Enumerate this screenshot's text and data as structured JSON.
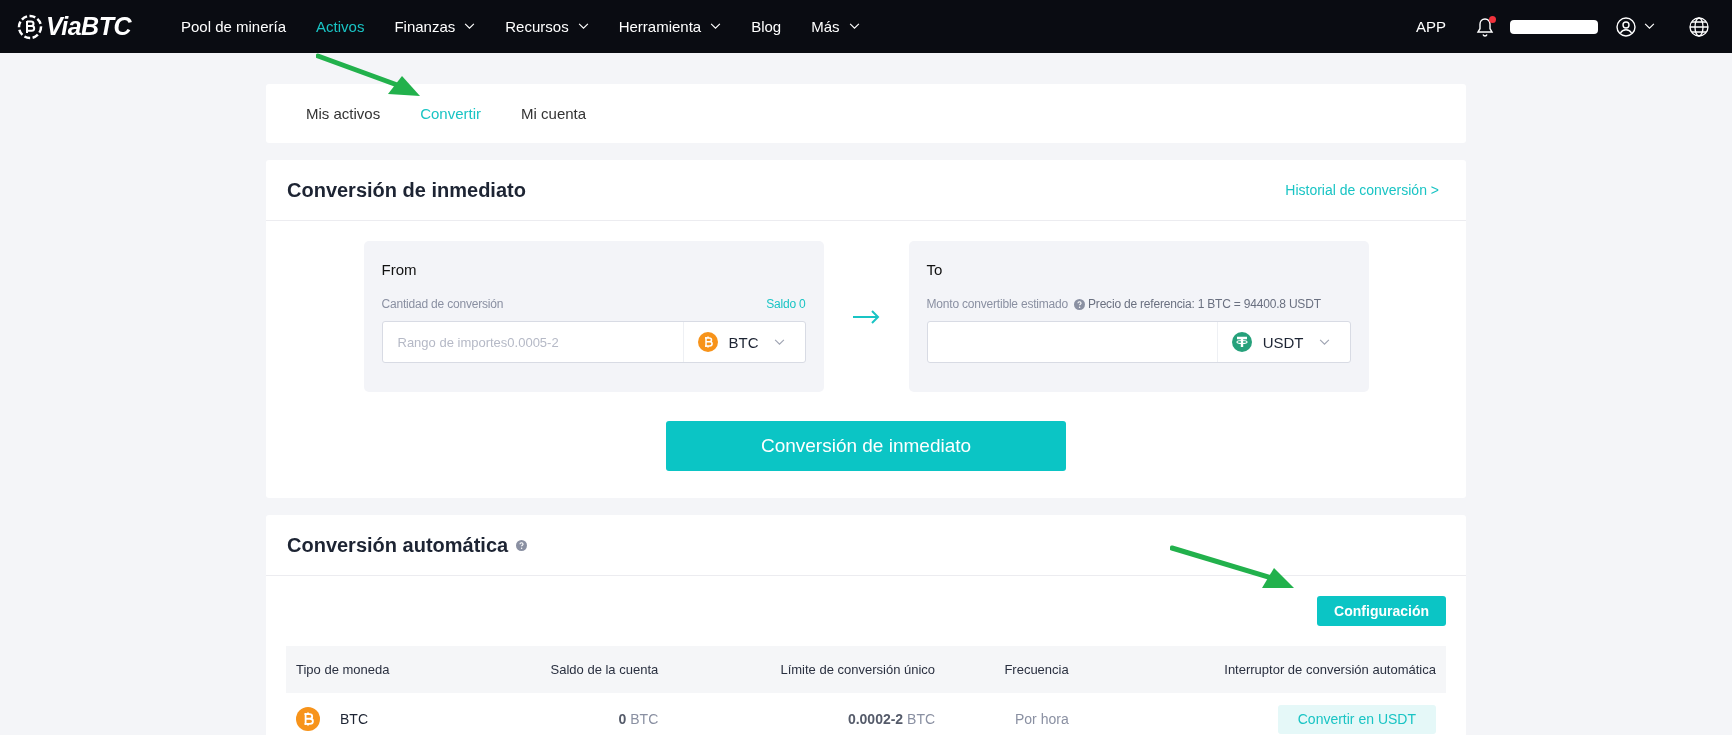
{
  "nav": {
    "logo": "ViaBTC",
    "items": [
      {
        "label": "Pool de minería",
        "selected": false,
        "dropdown": false
      },
      {
        "label": "Activos",
        "selected": true,
        "dropdown": false
      },
      {
        "label": "Finanzas",
        "selected": false,
        "dropdown": true
      },
      {
        "label": "Recursos",
        "selected": false,
        "dropdown": true
      },
      {
        "label": "Herramienta",
        "selected": false,
        "dropdown": true
      },
      {
        "label": "Blog",
        "selected": false,
        "dropdown": false
      },
      {
        "label": "Más",
        "selected": false,
        "dropdown": true
      }
    ],
    "app": "APP",
    "notifications_unread": true
  },
  "tabs": [
    {
      "label": "Mis activos",
      "selected": false
    },
    {
      "label": "Convertir",
      "selected": true
    },
    {
      "label": "Mi cuenta",
      "selected": false
    }
  ],
  "instant": {
    "title": "Conversión de inmediato",
    "history_link": "Historial de conversión >",
    "from": {
      "label": "From",
      "amount_label": "Cantidad de conversión",
      "balance": "Saldo 0",
      "placeholder": "Rango de importes0.0005-2",
      "currency": {
        "symbol": "BTC",
        "kind": "bitcoin"
      }
    },
    "to": {
      "label": "To",
      "amount_label": "Monto convertible estimado",
      "reference": "Precio de referencia: 1 BTC = 94400.8 USDT",
      "currency": {
        "symbol": "USDT",
        "kind": "tether"
      }
    },
    "button": "Conversión de inmediato"
  },
  "auto": {
    "title": "Conversión automática",
    "config_button": "Configuración",
    "columns": [
      "Tipo de moneda",
      "Saldo de la cuenta",
      "Límite de conversión único",
      "Frecuencia",
      "Interruptor de conversión automática"
    ],
    "rows": [
      {
        "currency": {
          "symbol": "BTC",
          "kind": "bitcoin"
        },
        "balance": "**0** BTC",
        "limit": "**0.0002-2** BTC",
        "frequency": "Por hora",
        "action": "Convertir en USDT"
      }
    ]
  }
}
